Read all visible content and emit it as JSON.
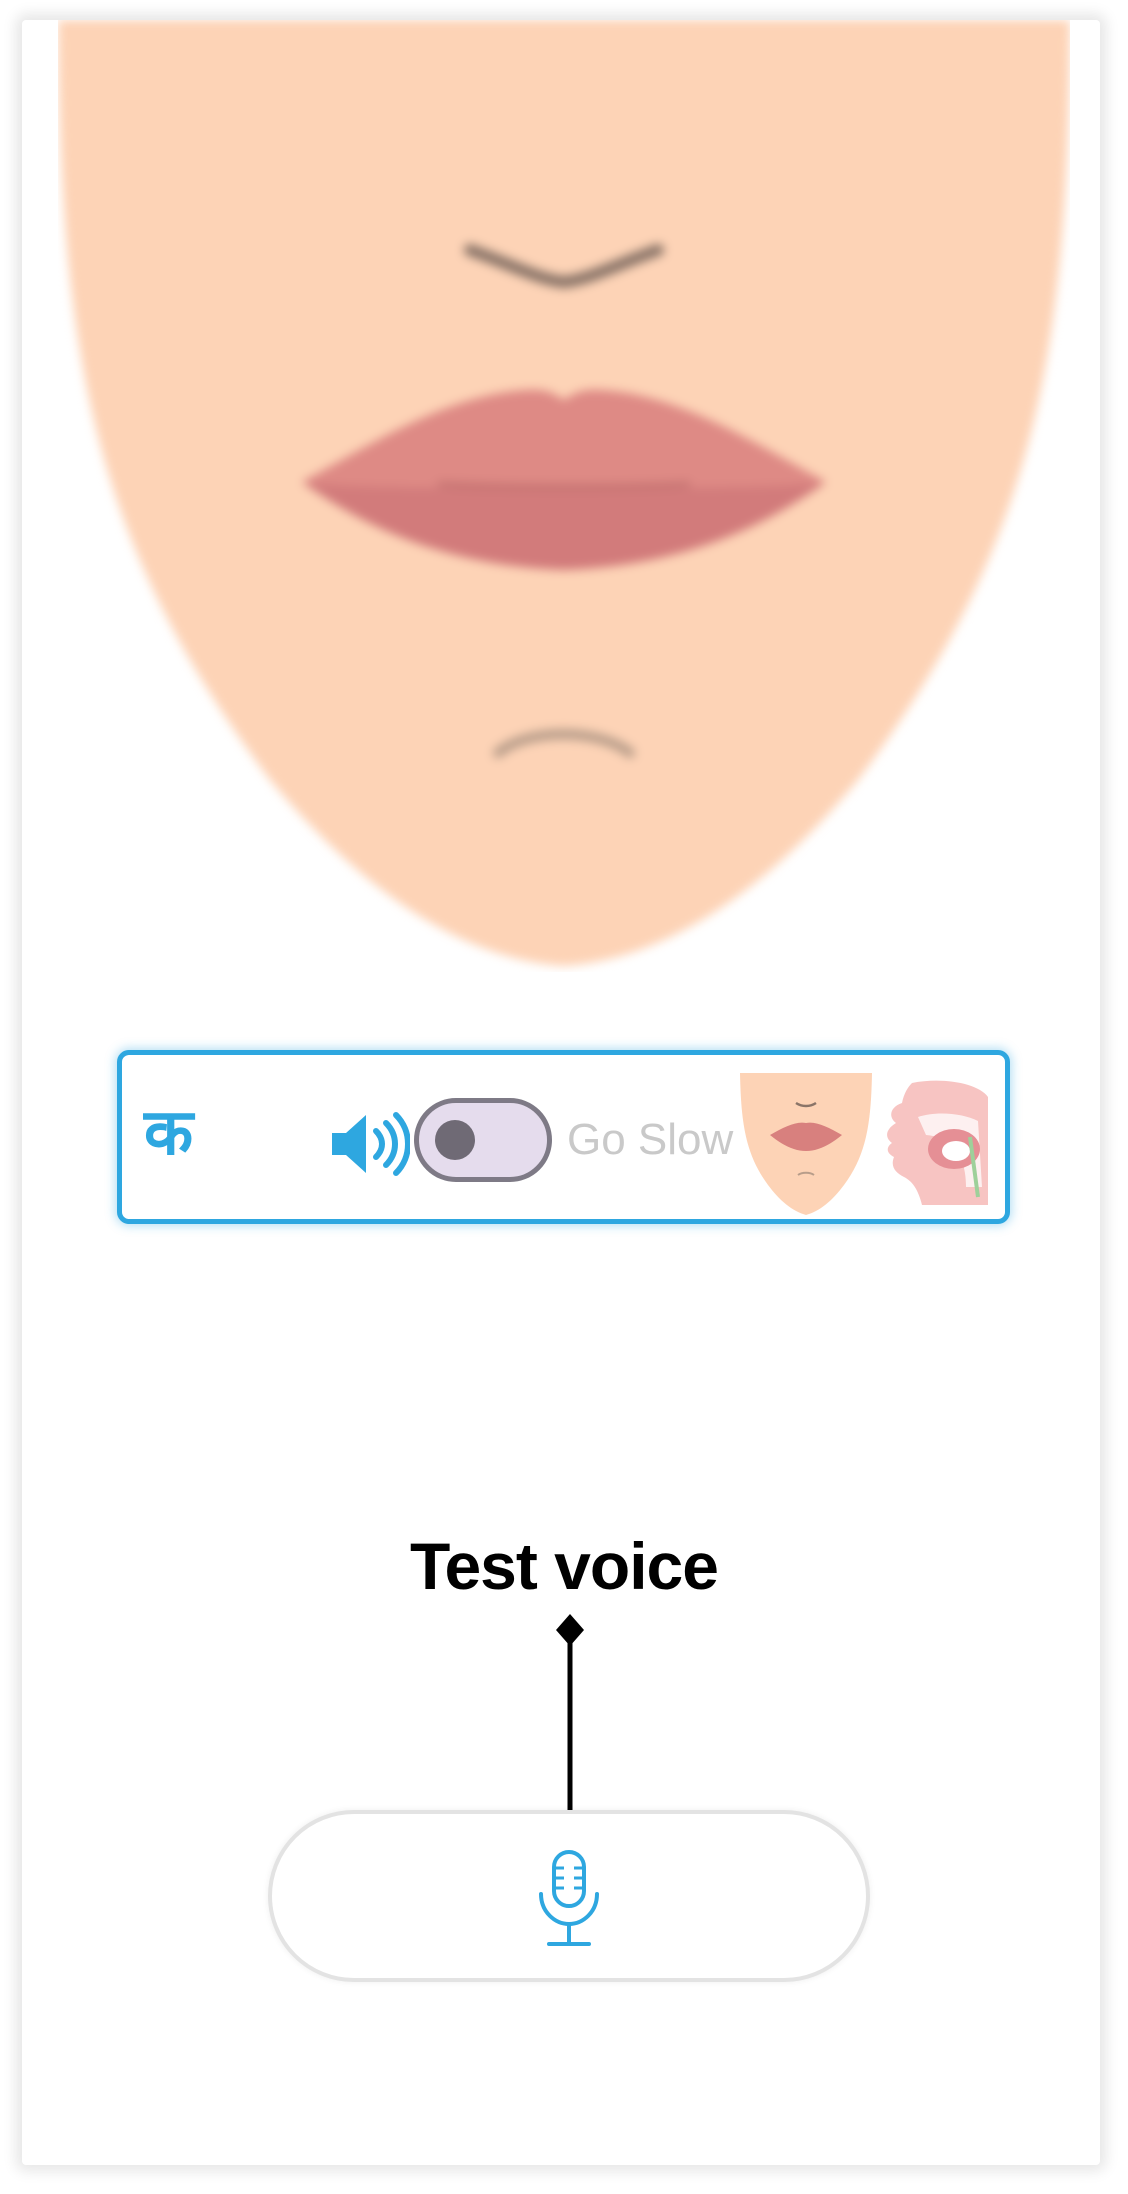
{
  "colors": {
    "accent": "#2ea7e0",
    "skin": "#fdd3b6",
    "lips_upper": "#de8a85",
    "lips_lower": "#d27b7b",
    "toggle_track": "#e5dced",
    "toggle_knob": "#6f6a75"
  },
  "control_bar": {
    "letter": "क",
    "speaker_icon": "speaker-volume-icon",
    "go_slow_label": "Go Slow",
    "go_slow_enabled": false,
    "face_view_icon": "face-front-thumbnail",
    "mouth_view_icon": "mouth-sagittal-thumbnail"
  },
  "test_voice": {
    "label": "Test voice"
  },
  "mic_button": {
    "icon": "microphone-icon"
  }
}
